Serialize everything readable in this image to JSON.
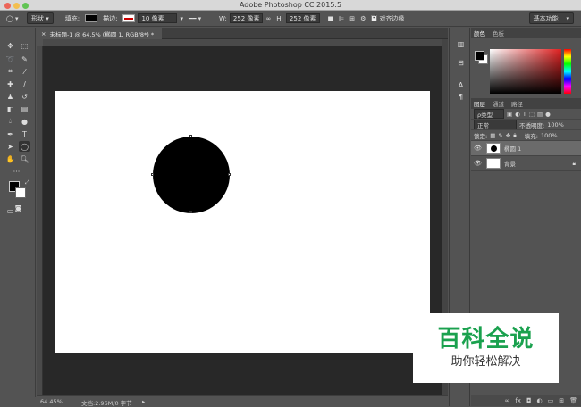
{
  "window": {
    "title": "Adobe Photoshop CC 2015.5"
  },
  "options": {
    "tool_mode": "形状",
    "fill_label": "填充:",
    "stroke_label": "描边:",
    "stroke_width": "10 像素",
    "w_label": "W:",
    "w_value": "252 像素",
    "h_label": "H:",
    "h_value": "252 像素",
    "align_edges": "对齐边缘",
    "workspace": "基本功能"
  },
  "document": {
    "tab_title": "未标题-1 @ 64.5% (椭圆 1, RGB/8*) *",
    "zoom": "64.45%",
    "doc_info": "文档:2.96M/0 字节"
  },
  "color_panel": {
    "tabs": [
      "颜色",
      "色板"
    ]
  },
  "layers_panel": {
    "tabs": [
      "图层",
      "通道",
      "路径"
    ],
    "filter_kind": "ρ类型",
    "blend_mode": "正常",
    "opacity_label": "不透明度:",
    "opacity_value": "100%",
    "lock_label": "锁定:",
    "fill_label": "填充:",
    "fill_value": "100%",
    "layers": [
      {
        "name": "椭圆 1",
        "selected": true
      },
      {
        "name": "背景",
        "selected": false
      }
    ]
  },
  "watermark": {
    "title": "百科全说",
    "subtitle": "助你轻松解决"
  },
  "colors": {
    "fill": "#000000",
    "accent_green": "#1aa14e"
  }
}
